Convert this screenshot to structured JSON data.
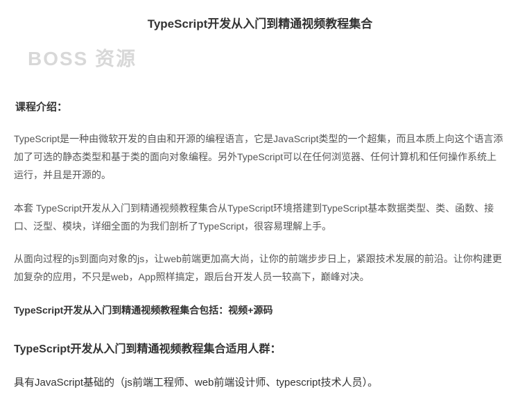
{
  "title": "TypeScript开发从入门到精通视频教程集合",
  "watermark": "BOSS 资源",
  "intro_label": "课程介绍：",
  "paragraphs": {
    "p1": "TypeScript是一种由微软开发的自由和开源的编程语言，它是JavaScript类型的一个超集，而且本质上向这个语言添加了可选的静态类型和基于类的面向对象编程。另外TypeScript可以在任何浏览器、任何计算机和任何操作系统上运行，并且是开源的。",
    "p2": "本套 TypeScript开发从入门到精通视频教程集合从TypeScript环境搭建到TypeScript基本数据类型、类、函数、接口、泛型、模块，详细全面的为我们剖析了TypeScript，很容易理解上手。",
    "p3": "从面向过程的js到面向对象的js，让web前端更加高大尚，让你的前端步步日上，紧跟技术发展的前沿。让你构建更加复杂的应用，不只是web，App照样搞定，跟后台开发人员一较高下，巅峰对决。"
  },
  "includes_line": "TypeScript开发从入门到精通视频教程集合包括：视频+源码",
  "audience_heading": "TypeScript开发从入门到精通视频教程集合适用人群：",
  "audience_text": "具有JavaScript基础的（js前端工程师、web前端设计师、typescript技术人员）。"
}
